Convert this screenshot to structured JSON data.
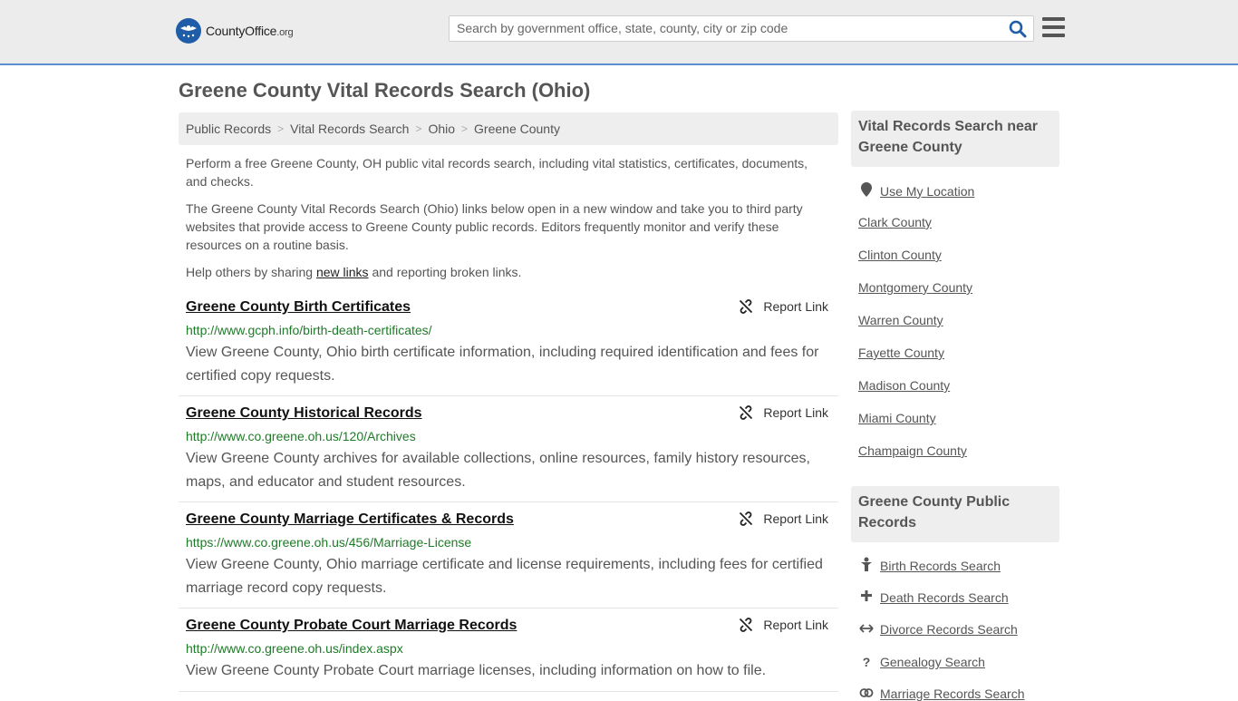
{
  "header": {
    "logo_text_main": "CountyOffice",
    "logo_text_suffix": ".org",
    "search_placeholder": "Search by government office, state, county, city or zip code"
  },
  "page_title": "Greene County Vital Records Search (Ohio)",
  "breadcrumbs": [
    "Public Records",
    "Vital Records Search",
    "Ohio",
    "Greene County"
  ],
  "intro": {
    "p1": "Perform a free Greene County, OH public vital records search, including vital statistics, certificates, documents, and checks.",
    "p2": "The Greene County Vital Records Search (Ohio) links below open in a new window and take you to third party websites that provide access to Greene County public records. Editors frequently monitor and verify these resources on a routine basis.",
    "p3_before": "Help others by sharing ",
    "p3_link": "new links",
    "p3_after": " and reporting broken links."
  },
  "report_label": "Report Link",
  "results": [
    {
      "title": "Greene County Birth Certificates",
      "url": "http://www.gcph.info/birth-death-certificates/",
      "desc": "View Greene County, Ohio birth certificate information, including required identification and fees for certified copy requests."
    },
    {
      "title": "Greene County Historical Records",
      "url": "http://www.co.greene.oh.us/120/Archives",
      "desc": "View Greene County archives for available collections, online resources, family history resources, maps, and educator and student resources."
    },
    {
      "title": "Greene County Marriage Certificates & Records",
      "url": "https://www.co.greene.oh.us/456/Marriage-License",
      "desc": "View Greene County, Ohio marriage certificate and license requirements, including fees for certified marriage record copy requests."
    },
    {
      "title": "Greene County Probate Court Marriage Records",
      "url": "http://www.co.greene.oh.us/index.aspx",
      "desc": "View Greene County Probate Court marriage licenses, including information on how to file."
    }
  ],
  "sidebar": {
    "nearby_heading": "Vital Records Search near Greene County",
    "use_location": "Use My Location",
    "nearby": [
      "Clark County",
      "Clinton County",
      "Montgomery County",
      "Warren County",
      "Fayette County",
      "Madison County",
      "Miami County",
      "Champaign County"
    ],
    "public_heading": "Greene County Public Records",
    "public_links": [
      {
        "label": "Birth Records Search",
        "icon": "baby-icon"
      },
      {
        "label": "Death Records Search",
        "icon": "cross-icon"
      },
      {
        "label": "Divorce Records Search",
        "icon": "arrows-icon"
      },
      {
        "label": "Genealogy Search",
        "icon": "question-icon"
      },
      {
        "label": "Marriage Records Search",
        "icon": "rings-icon"
      }
    ]
  },
  "colors": {
    "accent": "#5b8fd0",
    "url_green": "#1e7b27",
    "logo_blue": "#1f5da8"
  }
}
